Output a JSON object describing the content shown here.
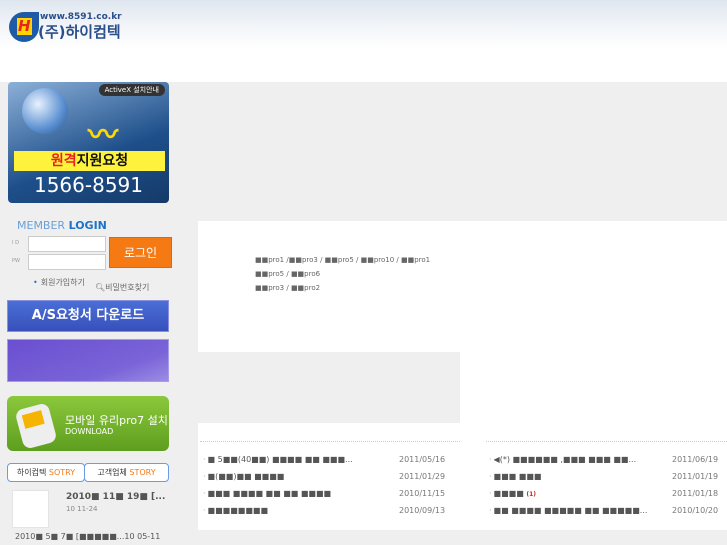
{
  "header": {
    "logo_mark": "H",
    "url": "www.8591.co.kr",
    "company": "(주)하이컴텍"
  },
  "banner": {
    "activex": "ActiveX 설치안내",
    "request_red": "원격",
    "request_rest": "지원요청",
    "phone": "1566-8591"
  },
  "login": {
    "title_a": "MEMBER",
    "title_b": "LOGIN",
    "id_label": "I D",
    "pw_label": "PW",
    "id_value": "",
    "pw_value": "",
    "button": "로그인",
    "join": "회원가입하기",
    "find_pw": "비밀번호찾기"
  },
  "sidebar": {
    "as_download": "A/S요청서 다운로드",
    "mobile_title": "모바일 유리pro7 설치",
    "mobile_sub": "DOWNLOAD",
    "story_tab1_a": "하이컴텍",
    "story_tab1_b": "SOTRY",
    "story_tab2_a": "고객업체",
    "story_tab2_b": "STORY",
    "story_title": "2010■ 11■ 19■ [...",
    "story_date": "10 11-24",
    "story2": "2010■ 5■ 7■ [■■■■■...10 05-11"
  },
  "products": [
    "■■pro1 /■■pro3 / ■■pro5 / ■■pro10 / ■■pro1",
    "■■pro5 / ■■pro6",
    "■■pro3 / ■■pro2"
  ],
  "news_left": [
    {
      "title": "■ 5■■(40■■) ■■■■ ■■ ■■■...",
      "date": "2011/05/16"
    },
    {
      "title": "■(■■)■■ ■■■■",
      "date": "2011/01/29"
    },
    {
      "title": "■■■ ■■■■ ■■ ■■ ■■■■",
      "date": "2010/11/15"
    },
    {
      "title": "■■■■■■■■",
      "date": "2010/09/13"
    }
  ],
  "news_right": [
    {
      "title": "◀(*) ■■■■■■ ,■■■ ■■■ ■■...",
      "date": "2011/06/19",
      "badge": ""
    },
    {
      "title": "■■■ ■■■",
      "date": "2011/01/19",
      "badge": ""
    },
    {
      "title": "■■■■",
      "date": "2011/01/18",
      "badge": "(1)"
    },
    {
      "title": "■■ ■■■■ ■■■■■ ■■ ■■■■■...",
      "date": "2010/10/20",
      "badge": ""
    }
  ]
}
